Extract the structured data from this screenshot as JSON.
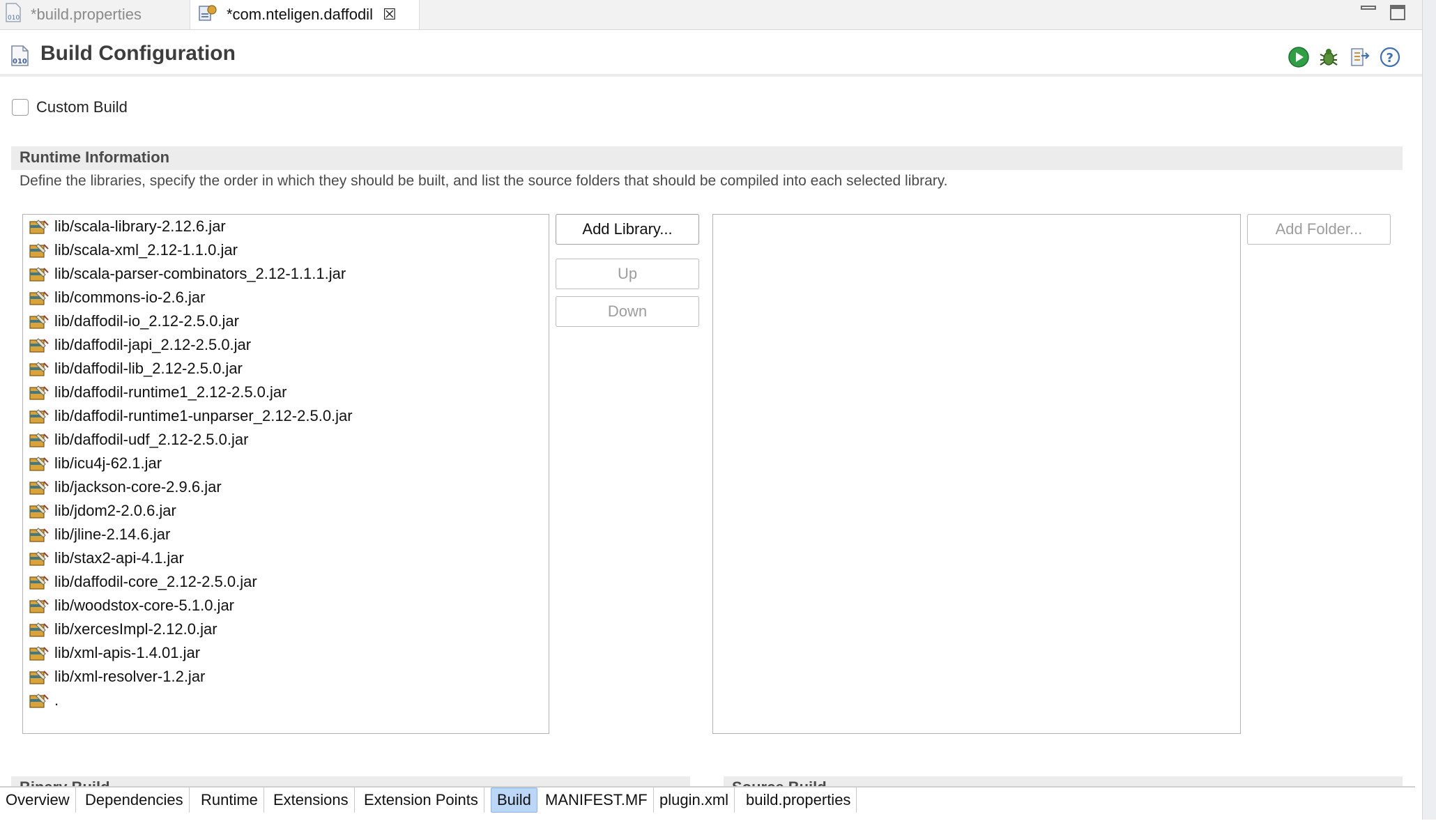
{
  "editor_tabs": [
    {
      "label": "*build.properties",
      "icon": "properties-file-icon"
    },
    {
      "label": "*com.nteligen.daffodil",
      "icon": "plugin-manifest-icon"
    }
  ],
  "header": {
    "title": "Build Configuration",
    "icon": "build-config-icon",
    "tools": [
      "run-icon",
      "debug-icon",
      "export-icon",
      "help-icon"
    ]
  },
  "custom_build": {
    "label": "Custom Build",
    "checked": false
  },
  "runtime": {
    "title": "Runtime Information",
    "description": "Define the libraries, specify the order in which they should be built, and list the source folders that should be compiled into each selected library."
  },
  "libraries": [
    "lib/scala-library-2.12.6.jar",
    "lib/scala-xml_2.12-1.1.0.jar",
    "lib/scala-parser-combinators_2.12-1.1.1.jar",
    "lib/commons-io-2.6.jar",
    "lib/daffodil-io_2.12-2.5.0.jar",
    "lib/daffodil-japi_2.12-2.5.0.jar",
    "lib/daffodil-lib_2.12-2.5.0.jar",
    "lib/daffodil-runtime1_2.12-2.5.0.jar",
    "lib/daffodil-runtime1-unparser_2.12-2.5.0.jar",
    "lib/daffodil-udf_2.12-2.5.0.jar",
    "lib/icu4j-62.1.jar",
    "lib/jackson-core-2.9.6.jar",
    "lib/jdom2-2.0.6.jar",
    "lib/jline-2.14.6.jar",
    "lib/stax2-api-4.1.jar",
    "lib/daffodil-core_2.12-2.5.0.jar",
    "lib/woodstox-core-5.1.0.jar",
    "lib/xercesImpl-2.12.0.jar",
    "lib/xml-apis-1.4.01.jar",
    "lib/xml-resolver-1.2.jar",
    "."
  ],
  "buttons": {
    "add_library": "Add Library...",
    "up": "Up",
    "down": "Down",
    "add_folder": "Add Folder..."
  },
  "sections": {
    "binary_build": "Binary Build",
    "source_build": "Source Build"
  },
  "page_tabs": [
    {
      "label": "Overview",
      "active": false
    },
    {
      "label": "Dependencies",
      "active": false
    },
    {
      "label": "Runtime",
      "active": false
    },
    {
      "label": "Extensions",
      "active": false
    },
    {
      "label": "Extension Points",
      "active": false
    },
    {
      "label": "Build",
      "active": true
    },
    {
      "label": "MANIFEST.MF",
      "active": false
    },
    {
      "label": "plugin.xml",
      "active": false
    },
    {
      "label": "build.properties",
      "active": false
    }
  ],
  "colors": {
    "active_tab": "#bcd6f7",
    "section_header": "#ececec",
    "run_green": "#2f9e44"
  }
}
